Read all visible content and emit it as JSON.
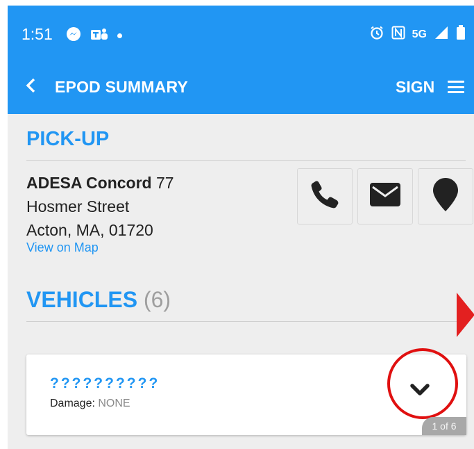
{
  "status_bar": {
    "time": "1:51",
    "network": "5G"
  },
  "app_bar": {
    "title": "EPOD SUMMARY",
    "sign_label": "SIGN"
  },
  "pickup": {
    "heading": "PICK-UP",
    "name": "ADESA Concord",
    "street_number": "77",
    "street": "Hosmer Street",
    "city_line": "Acton, MA, 01720",
    "map_link": "View on Map"
  },
  "vehicles": {
    "heading": "VEHICLES",
    "count": "(6)",
    "card": {
      "vin": "??????????",
      "damage_label": "Damage:",
      "damage_value": "NONE",
      "page": "1 of 6"
    }
  },
  "colors": {
    "primary": "#2196f3",
    "annotation_red": "#e01010",
    "icon_dark": "#222222"
  },
  "icons": [
    "messenger-icon",
    "teams-icon",
    "alarm-icon",
    "nfc-icon",
    "signal-icon",
    "battery-icon",
    "back-icon",
    "menu-icon",
    "phone-icon",
    "email-icon",
    "location-icon",
    "chevron-down-icon"
  ]
}
